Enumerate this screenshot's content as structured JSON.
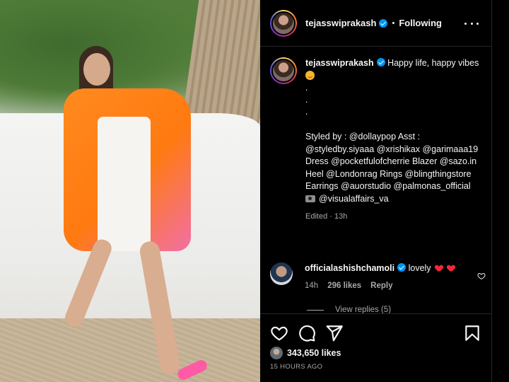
{
  "post": {
    "username": "tejasswiprakash",
    "separator": "•",
    "follow_state": "Following"
  },
  "caption": {
    "username": "tejasswiprakash",
    "first_line": "Happy life, happy vibes",
    "dots": [
      ".",
      ".",
      "."
    ],
    "styled_by": "Styled by : @dollaypop Asst : @styledby.siyaaa @xrishikax @garimaaa19 Dress @pocketfulofcherrie Blazer @sazo.in Heel @Londonrag Rings @blingthingstore Earrings @auorstudio @palmonas_official",
    "photo_credit": "@visualaffairs_va",
    "edited": "Edited · 13h"
  },
  "comment": {
    "username": "officialashishchamoli",
    "text": "lovely",
    "time": "14h",
    "likes": "296 likes",
    "reply": "Reply",
    "view_replies": "View replies (5)"
  },
  "actions": {
    "like_count": "343,650 likes",
    "timestamp": "15 HOURS AGO"
  },
  "icons": {
    "more": "more-options-icon",
    "like": "heart-icon",
    "comment": "comment-icon",
    "share": "share-icon",
    "save": "bookmark-icon"
  },
  "colors": {
    "background": "#000000",
    "verified": "#0095f6",
    "muted_text": "#a8a8a8",
    "heart_emoji": "#ed2939"
  }
}
